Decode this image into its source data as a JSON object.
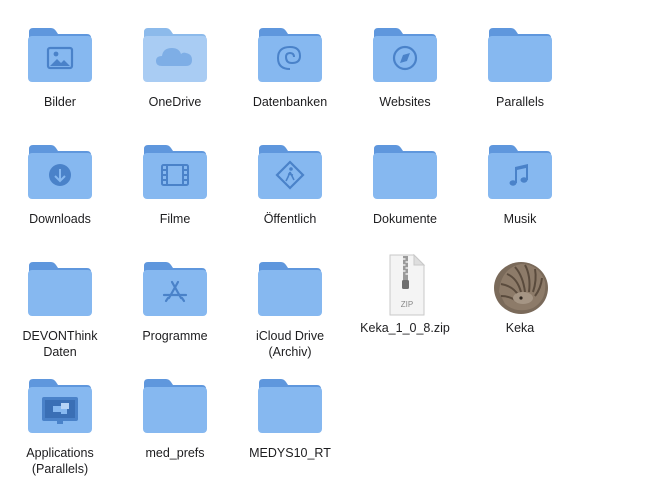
{
  "colors": {
    "folder_back": "#5f97dd",
    "folder_front": "#86b8f0",
    "folder_glyph": "#4a82c9",
    "label_text": "#1d1d1f"
  },
  "items": [
    {
      "label": "Bilder",
      "kind": "folder",
      "glyph": "photo-icon"
    },
    {
      "label": "OneDrive",
      "kind": "folder-light",
      "glyph": "cloud-icon"
    },
    {
      "label": "Datenbanken",
      "kind": "folder",
      "glyph": "nautilus-icon"
    },
    {
      "label": "Websites",
      "kind": "folder",
      "glyph": "compass-icon"
    },
    {
      "label": "Parallels",
      "kind": "folder",
      "glyph": ""
    },
    {
      "label": "Downloads",
      "kind": "folder",
      "glyph": "download-arrow-icon"
    },
    {
      "label": "Filme",
      "kind": "folder",
      "glyph": "film-strip-icon"
    },
    {
      "label": "Öffentlich",
      "kind": "folder",
      "glyph": "public-sign-icon"
    },
    {
      "label": "Dokumente",
      "kind": "folder",
      "glyph": ""
    },
    {
      "label": "Musik",
      "kind": "folder",
      "glyph": "music-note-icon"
    },
    {
      "label": "DEVONThink\nDaten",
      "kind": "folder",
      "glyph": ""
    },
    {
      "label": "Programme",
      "kind": "folder",
      "glyph": "app-store-icon"
    },
    {
      "label": "iCloud Drive\n(Archiv)",
      "kind": "folder",
      "glyph": ""
    },
    {
      "label": "Keka_1_0_8.zip",
      "kind": "zip",
      "glyph": "zip-file-icon",
      "badge": "ZIP"
    },
    {
      "label": "Keka",
      "kind": "app",
      "glyph": "keka-app-icon"
    },
    {
      "label": "Applications\n(Parallels)",
      "kind": "folder",
      "glyph": "parallels-screen-icon"
    },
    {
      "label": "med_prefs",
      "kind": "folder",
      "glyph": ""
    },
    {
      "label": "MEDYS10_RT",
      "kind": "folder",
      "glyph": ""
    }
  ]
}
